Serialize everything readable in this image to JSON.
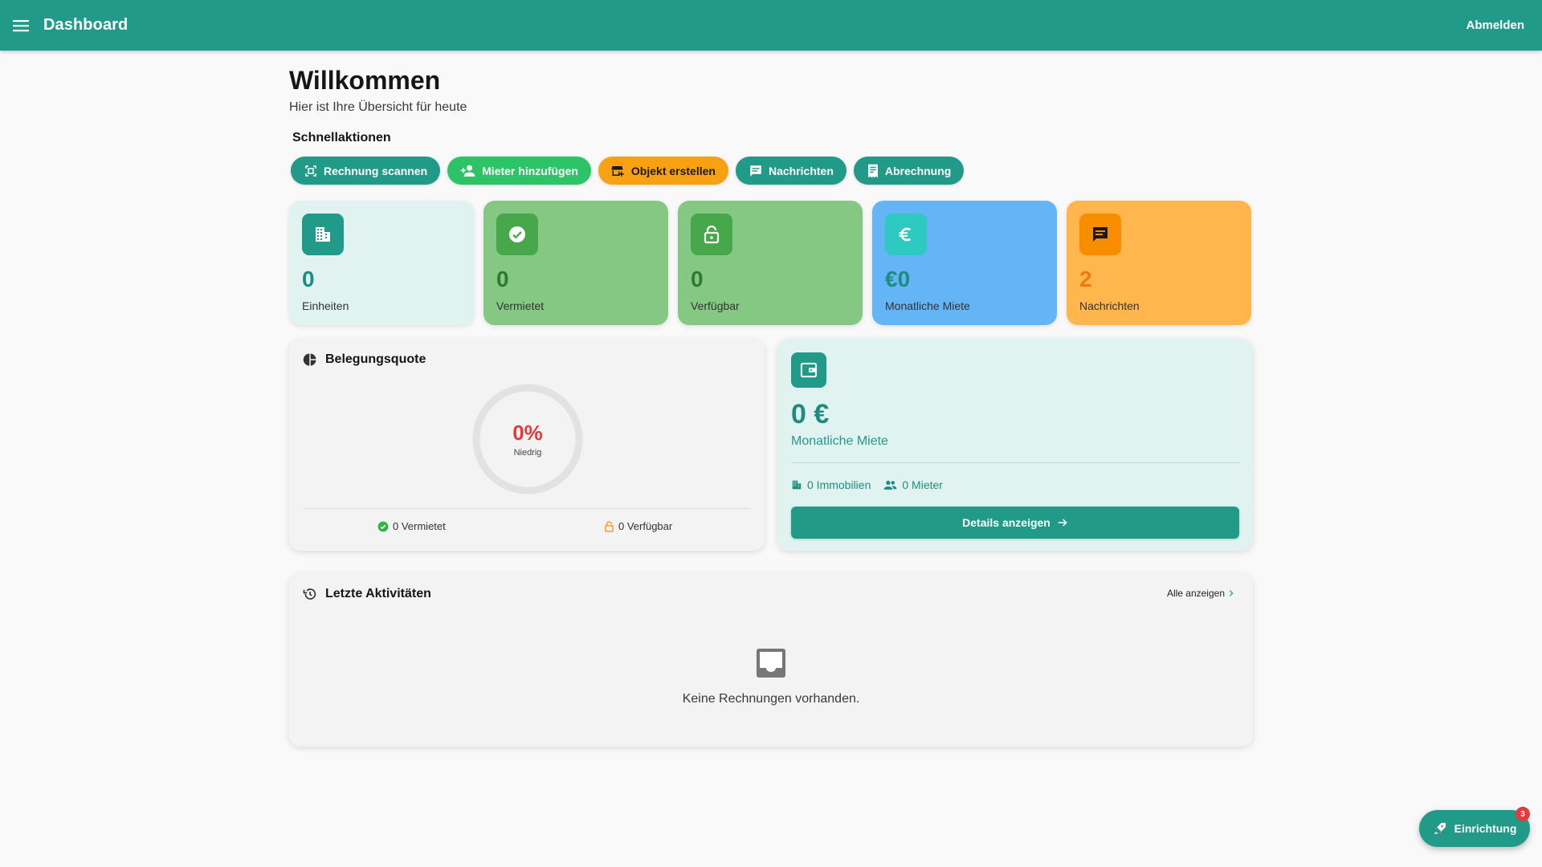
{
  "header": {
    "title": "Dashboard",
    "logout_label": "Abmelden",
    "menu_icon": "hamburger-menu-icon",
    "bg_color": "#229a8a"
  },
  "welcome": {
    "title": "Willkommen",
    "subtitle": "Hier ist Ihre Übersicht für heute"
  },
  "quick_actions": {
    "title": "Schnellaktionen",
    "items": [
      {
        "label": "Rechnung scannen",
        "icon": "document-scanner-icon",
        "color": "#229a8a"
      },
      {
        "label": "Mieter hinzufügen",
        "icon": "person-add-icon",
        "color": "#2cc466"
      },
      {
        "label": "Objekt erstellen",
        "icon": "add-business-icon",
        "color": "#f8a112"
      },
      {
        "label": "Nachrichten",
        "icon": "message-icon",
        "color": "#229a8a"
      },
      {
        "label": "Abrechnung",
        "icon": "receipt-icon",
        "color": "#229a8a"
      }
    ]
  },
  "stats": [
    {
      "value": "0",
      "label": "Einheiten",
      "icon": "building-icon",
      "bg": "#e0f3f1",
      "icon_bg": "#229a8a",
      "value_color": "#1d8d7f"
    },
    {
      "value": "0",
      "label": "Vermietet",
      "icon": "check-circle-icon",
      "bg": "#84c884",
      "icon_bg": "#46a84a",
      "value_color": "#2e7a35"
    },
    {
      "value": "0",
      "label": "Verfügbar",
      "icon": "lock-open-icon",
      "bg": "#84c884",
      "icon_bg": "#46a84a",
      "value_color": "#2e7a35"
    },
    {
      "value": "€0",
      "label": "Monatliche Miete",
      "icon": "euro-icon",
      "bg": "#64b5f6",
      "icon_bg": "#2ec9c0",
      "value_color": "#1d8d7f"
    },
    {
      "value": "2",
      "label": "Nachrichten",
      "icon": "chat-icon",
      "bg": "#ffb74d",
      "icon_bg": "#f88d00",
      "value_color": "#ef7a10"
    }
  ],
  "occupancy": {
    "title": "Belegungsquote",
    "percent": "0%",
    "percent_value": 0,
    "status": "Niedrig",
    "rented": "0 Vermietet",
    "available": "0 Verfügbar"
  },
  "rent": {
    "value": "0 €",
    "label": "Monatliche Miete",
    "properties": "0 Immobilien",
    "tenants": "0 Mieter",
    "details_label": "Details anzeigen"
  },
  "activities": {
    "title": "Letzte Aktivitäten",
    "see_all": "Alle anzeigen",
    "empty_text": "Keine Rechnungen vorhanden."
  },
  "setup": {
    "label": "Einrichtung",
    "badge": "3"
  }
}
